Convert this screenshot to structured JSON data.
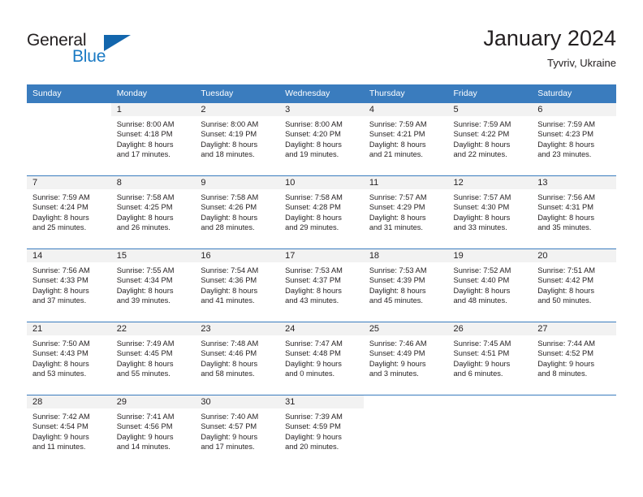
{
  "brand": {
    "name_part1": "General",
    "name_part2": "Blue",
    "logo_icon": "triangle-logo-icon",
    "accent_color": "#1366ad",
    "text_color": "#231f20"
  },
  "header": {
    "title": "January 2024",
    "subtitle": "Tyvriv, Ukraine"
  },
  "calendar": {
    "header_bg": "#3a7cbe",
    "header_text_color": "#ffffff",
    "daynum_bg": "#f2f2f2",
    "weekday_headers": [
      "Sunday",
      "Monday",
      "Tuesday",
      "Wednesday",
      "Thursday",
      "Friday",
      "Saturday"
    ],
    "weeks": [
      [
        {
          "day": "",
          "blank": true,
          "sunrise": "",
          "sunset": "",
          "daylight_line1": "",
          "daylight_line2": ""
        },
        {
          "day": "1",
          "sunrise": "Sunrise: 8:00 AM",
          "sunset": "Sunset: 4:18 PM",
          "daylight_line1": "Daylight: 8 hours",
          "daylight_line2": "and 17 minutes."
        },
        {
          "day": "2",
          "sunrise": "Sunrise: 8:00 AM",
          "sunset": "Sunset: 4:19 PM",
          "daylight_line1": "Daylight: 8 hours",
          "daylight_line2": "and 18 minutes."
        },
        {
          "day": "3",
          "sunrise": "Sunrise: 8:00 AM",
          "sunset": "Sunset: 4:20 PM",
          "daylight_line1": "Daylight: 8 hours",
          "daylight_line2": "and 19 minutes."
        },
        {
          "day": "4",
          "sunrise": "Sunrise: 7:59 AM",
          "sunset": "Sunset: 4:21 PM",
          "daylight_line1": "Daylight: 8 hours",
          "daylight_line2": "and 21 minutes."
        },
        {
          "day": "5",
          "sunrise": "Sunrise: 7:59 AM",
          "sunset": "Sunset: 4:22 PM",
          "daylight_line1": "Daylight: 8 hours",
          "daylight_line2": "and 22 minutes."
        },
        {
          "day": "6",
          "sunrise": "Sunrise: 7:59 AM",
          "sunset": "Sunset: 4:23 PM",
          "daylight_line1": "Daylight: 8 hours",
          "daylight_line2": "and 23 minutes."
        }
      ],
      [
        {
          "day": "7",
          "sunrise": "Sunrise: 7:59 AM",
          "sunset": "Sunset: 4:24 PM",
          "daylight_line1": "Daylight: 8 hours",
          "daylight_line2": "and 25 minutes."
        },
        {
          "day": "8",
          "sunrise": "Sunrise: 7:58 AM",
          "sunset": "Sunset: 4:25 PM",
          "daylight_line1": "Daylight: 8 hours",
          "daylight_line2": "and 26 minutes."
        },
        {
          "day": "9",
          "sunrise": "Sunrise: 7:58 AM",
          "sunset": "Sunset: 4:26 PM",
          "daylight_line1": "Daylight: 8 hours",
          "daylight_line2": "and 28 minutes."
        },
        {
          "day": "10",
          "sunrise": "Sunrise: 7:58 AM",
          "sunset": "Sunset: 4:28 PM",
          "daylight_line1": "Daylight: 8 hours",
          "daylight_line2": "and 29 minutes."
        },
        {
          "day": "11",
          "sunrise": "Sunrise: 7:57 AM",
          "sunset": "Sunset: 4:29 PM",
          "daylight_line1": "Daylight: 8 hours",
          "daylight_line2": "and 31 minutes."
        },
        {
          "day": "12",
          "sunrise": "Sunrise: 7:57 AM",
          "sunset": "Sunset: 4:30 PM",
          "daylight_line1": "Daylight: 8 hours",
          "daylight_line2": "and 33 minutes."
        },
        {
          "day": "13",
          "sunrise": "Sunrise: 7:56 AM",
          "sunset": "Sunset: 4:31 PM",
          "daylight_line1": "Daylight: 8 hours",
          "daylight_line2": "and 35 minutes."
        }
      ],
      [
        {
          "day": "14",
          "sunrise": "Sunrise: 7:56 AM",
          "sunset": "Sunset: 4:33 PM",
          "daylight_line1": "Daylight: 8 hours",
          "daylight_line2": "and 37 minutes."
        },
        {
          "day": "15",
          "sunrise": "Sunrise: 7:55 AM",
          "sunset": "Sunset: 4:34 PM",
          "daylight_line1": "Daylight: 8 hours",
          "daylight_line2": "and 39 minutes."
        },
        {
          "day": "16",
          "sunrise": "Sunrise: 7:54 AM",
          "sunset": "Sunset: 4:36 PM",
          "daylight_line1": "Daylight: 8 hours",
          "daylight_line2": "and 41 minutes."
        },
        {
          "day": "17",
          "sunrise": "Sunrise: 7:53 AM",
          "sunset": "Sunset: 4:37 PM",
          "daylight_line1": "Daylight: 8 hours",
          "daylight_line2": "and 43 minutes."
        },
        {
          "day": "18",
          "sunrise": "Sunrise: 7:53 AM",
          "sunset": "Sunset: 4:39 PM",
          "daylight_line1": "Daylight: 8 hours",
          "daylight_line2": "and 45 minutes."
        },
        {
          "day": "19",
          "sunrise": "Sunrise: 7:52 AM",
          "sunset": "Sunset: 4:40 PM",
          "daylight_line1": "Daylight: 8 hours",
          "daylight_line2": "and 48 minutes."
        },
        {
          "day": "20",
          "sunrise": "Sunrise: 7:51 AM",
          "sunset": "Sunset: 4:42 PM",
          "daylight_line1": "Daylight: 8 hours",
          "daylight_line2": "and 50 minutes."
        }
      ],
      [
        {
          "day": "21",
          "sunrise": "Sunrise: 7:50 AM",
          "sunset": "Sunset: 4:43 PM",
          "daylight_line1": "Daylight: 8 hours",
          "daylight_line2": "and 53 minutes."
        },
        {
          "day": "22",
          "sunrise": "Sunrise: 7:49 AM",
          "sunset": "Sunset: 4:45 PM",
          "daylight_line1": "Daylight: 8 hours",
          "daylight_line2": "and 55 minutes."
        },
        {
          "day": "23",
          "sunrise": "Sunrise: 7:48 AM",
          "sunset": "Sunset: 4:46 PM",
          "daylight_line1": "Daylight: 8 hours",
          "daylight_line2": "and 58 minutes."
        },
        {
          "day": "24",
          "sunrise": "Sunrise: 7:47 AM",
          "sunset": "Sunset: 4:48 PM",
          "daylight_line1": "Daylight: 9 hours",
          "daylight_line2": "and 0 minutes."
        },
        {
          "day": "25",
          "sunrise": "Sunrise: 7:46 AM",
          "sunset": "Sunset: 4:49 PM",
          "daylight_line1": "Daylight: 9 hours",
          "daylight_line2": "and 3 minutes."
        },
        {
          "day": "26",
          "sunrise": "Sunrise: 7:45 AM",
          "sunset": "Sunset: 4:51 PM",
          "daylight_line1": "Daylight: 9 hours",
          "daylight_line2": "and 6 minutes."
        },
        {
          "day": "27",
          "sunrise": "Sunrise: 7:44 AM",
          "sunset": "Sunset: 4:52 PM",
          "daylight_line1": "Daylight: 9 hours",
          "daylight_line2": "and 8 minutes."
        }
      ],
      [
        {
          "day": "28",
          "sunrise": "Sunrise: 7:42 AM",
          "sunset": "Sunset: 4:54 PM",
          "daylight_line1": "Daylight: 9 hours",
          "daylight_line2": "and 11 minutes."
        },
        {
          "day": "29",
          "sunrise": "Sunrise: 7:41 AM",
          "sunset": "Sunset: 4:56 PM",
          "daylight_line1": "Daylight: 9 hours",
          "daylight_line2": "and 14 minutes."
        },
        {
          "day": "30",
          "sunrise": "Sunrise: 7:40 AM",
          "sunset": "Sunset: 4:57 PM",
          "daylight_line1": "Daylight: 9 hours",
          "daylight_line2": "and 17 minutes."
        },
        {
          "day": "31",
          "sunrise": "Sunrise: 7:39 AM",
          "sunset": "Sunset: 4:59 PM",
          "daylight_line1": "Daylight: 9 hours",
          "daylight_line2": "and 20 minutes."
        },
        {
          "day": "",
          "blank": true,
          "sunrise": "",
          "sunset": "",
          "daylight_line1": "",
          "daylight_line2": ""
        },
        {
          "day": "",
          "blank": true,
          "sunrise": "",
          "sunset": "",
          "daylight_line1": "",
          "daylight_line2": ""
        },
        {
          "day": "",
          "blank": true,
          "sunrise": "",
          "sunset": "",
          "daylight_line1": "",
          "daylight_line2": ""
        }
      ]
    ]
  }
}
